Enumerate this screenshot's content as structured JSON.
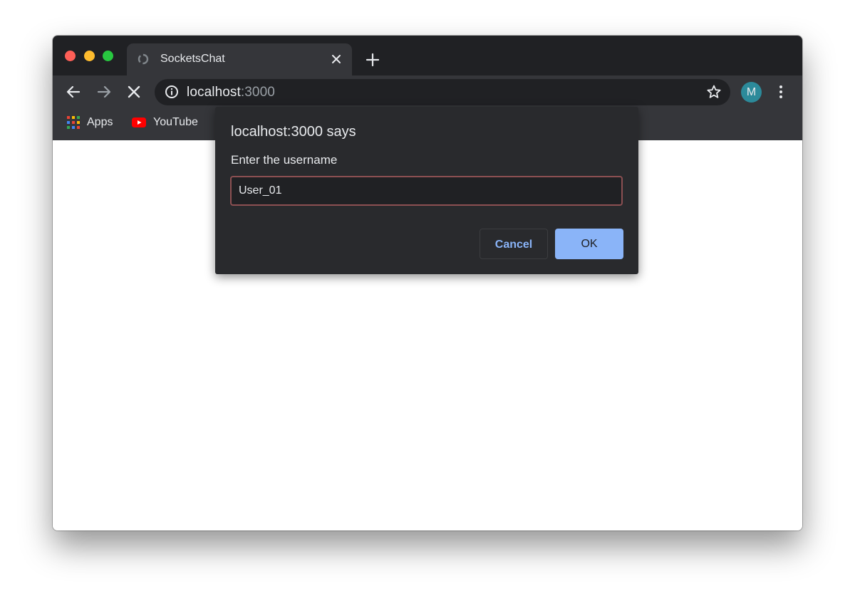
{
  "browser": {
    "tab": {
      "title": "SocketsChat"
    },
    "address": {
      "host": "localhost",
      "port": ":3000"
    },
    "profile_initial": "M",
    "bookmarks": [
      {
        "label": "Apps",
        "icon": "apps-grid-icon"
      },
      {
        "label": "YouTube",
        "icon": "youtube-icon"
      }
    ]
  },
  "dialog": {
    "title": "localhost:3000 says",
    "message": "Enter the username",
    "input_value": "User_01",
    "cancel_label": "Cancel",
    "ok_label": "OK"
  },
  "colors": {
    "titlebar": "#202124",
    "toolbar": "#35363a",
    "dialog_bg": "#292a2d",
    "accent": "#8ab4f8",
    "input_border": "#8c5052",
    "avatar": "#2c8a9a"
  }
}
